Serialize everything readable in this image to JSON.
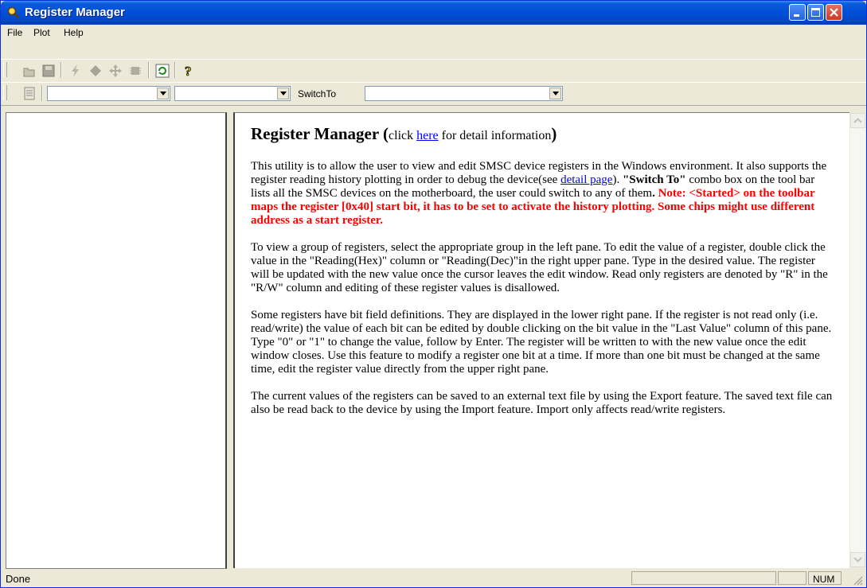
{
  "window": {
    "title": "Register Manager"
  },
  "menu": {
    "items": [
      "File",
      "Plot",
      "Help"
    ]
  },
  "toolbar2": {
    "switch_label": "SwitchTo",
    "combo1": "",
    "combo2": "",
    "combo3": ""
  },
  "content": {
    "heading_main": "Register Manager",
    "heading_paren_open": " (",
    "heading_click": "click ",
    "heading_link": "here",
    "heading_rest": " for detail information",
    "heading_paren_close": ")",
    "p1_a": "This  utility is to allow the user to view and edit SMSC device registers in the Windows environment. It also supports the register reading history plotting in order to debug the device(see ",
    "p1_link": "detail page",
    "p1_b": "). ",
    "p1_bold": "\"Switch To\"",
    "p1_c": " combo box on the tool bar lists all the SMSC devices on the motherboard, the user could switch to any of them",
    "p1_dot": ".",
    "p1_note": " Note:  <Started> on the toolbar maps the register [0x40] start bit, it has to be set to activate the history plotting. Some chips might use different address as a start register.",
    "p2": "To view a group of registers, select the appropriate group in the left pane. To edit the value of a register, double click the value in the \"Reading(Hex)\" column or \"Reading(Dec)\"in the right upper pane. Type in the desired value. The register will be updated with the new value once the cursor leaves the edit window. Read only registers are denoted by \"R\" in the \"R/W\" column and editing of these register values is disallowed.",
    "p3": "Some registers have bit field definitions. They are displayed in the lower right pane. If the register is not read only (i.e. read/write) the value of each bit can be edited by double clicking on the bit value in the \"Last Value\" column of this pane. Type \"0\" or \"1\" to change the value, follow by Enter. The register will be written to with the new value once the edit window closes. Use this feature to modify a register one bit at a time. If more than one bit must be changed at the same time, edit the register value directly from the upper right pane.",
    "p4": "The current values of the registers can be saved to an external text file by using the Export feature. The saved text file can also be read back to the device by using the Import feature. Import only affects read/write registers."
  },
  "status": {
    "text": "Done",
    "num": "NUM"
  },
  "colors": {
    "title_bar": "#0050d8",
    "note_red": "#ff0000",
    "link": "#0000ee"
  }
}
